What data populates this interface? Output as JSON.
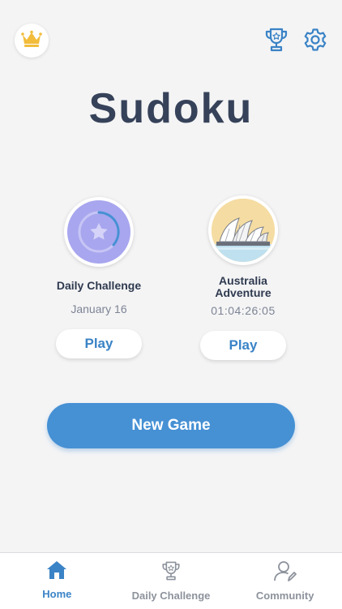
{
  "header": {
    "title": "Sudoku",
    "icons": {
      "crown": "crown-icon",
      "trophy": "trophy-icon",
      "settings": "gear-icon"
    }
  },
  "cards": [
    {
      "title": "Daily Challenge",
      "subtitle": "January 16",
      "play_label": "Play",
      "icon": "star-icon",
      "progress": 0.3
    },
    {
      "title": "Australia\nAdventure",
      "subtitle": "01:04:26:05",
      "play_label": "Play",
      "icon": "sydney-opera-house-icon"
    }
  ],
  "new_game_label": "New Game",
  "tabbar": {
    "items": [
      {
        "label": "Home",
        "icon": "home-icon",
        "active": true
      },
      {
        "label": "Daily Challenge",
        "icon": "trophy-icon",
        "active": false
      },
      {
        "label": "Community",
        "icon": "user-edit-icon",
        "active": false
      }
    ]
  },
  "colors": {
    "accent": "#4690d4",
    "crown": "#f2bd3c",
    "title": "#364259",
    "daily_badge": "#a8a6ee"
  }
}
